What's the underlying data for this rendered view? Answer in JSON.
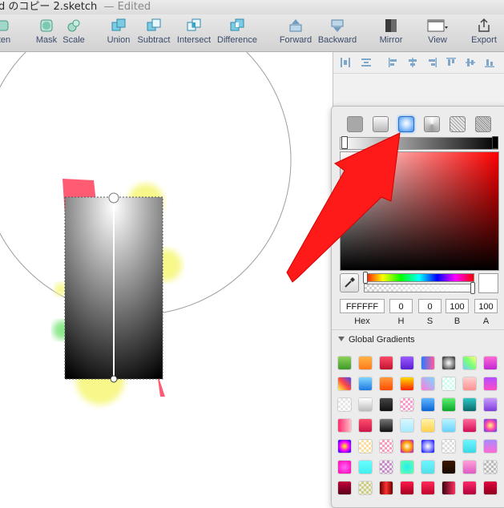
{
  "window": {
    "title": "d のコピー 2.sketch",
    "status": "— Edited"
  },
  "toolbar": {
    "items": [
      {
        "label": "tten",
        "icon": "flatten-icon"
      },
      {
        "label": "Mask",
        "icon": "mask-icon"
      },
      {
        "label": "Scale",
        "icon": "scale-icon"
      },
      {
        "label": "Union",
        "icon": "union-icon"
      },
      {
        "label": "Subtract",
        "icon": "subtract-icon"
      },
      {
        "label": "Intersect",
        "icon": "intersect-icon"
      },
      {
        "label": "Difference",
        "icon": "difference-icon"
      },
      {
        "label": "Forward",
        "icon": "forward-icon"
      },
      {
        "label": "Backward",
        "icon": "backward-icon"
      },
      {
        "label": "Mirror",
        "icon": "mirror-icon"
      },
      {
        "label": "View",
        "icon": "view-icon"
      },
      {
        "label": "Export",
        "icon": "export-icon"
      }
    ]
  },
  "color_picker": {
    "fill_types": [
      "flat-color",
      "linear-gradient",
      "radial-gradient",
      "angular-gradient",
      "pattern-fill",
      "noise-fill"
    ],
    "selected_fill_type": "radial-gradient",
    "fields": {
      "hex_value": "FFFFFF",
      "hex_label": "Hex",
      "h_value": "0",
      "h_label": "H",
      "s_value": "0",
      "s_label": "S",
      "b_value": "100",
      "b_label": "B",
      "a_value": "100",
      "a_label": "A"
    },
    "global_gradients_label": "Global Gradients",
    "accent_color": "#ff1a1a"
  }
}
